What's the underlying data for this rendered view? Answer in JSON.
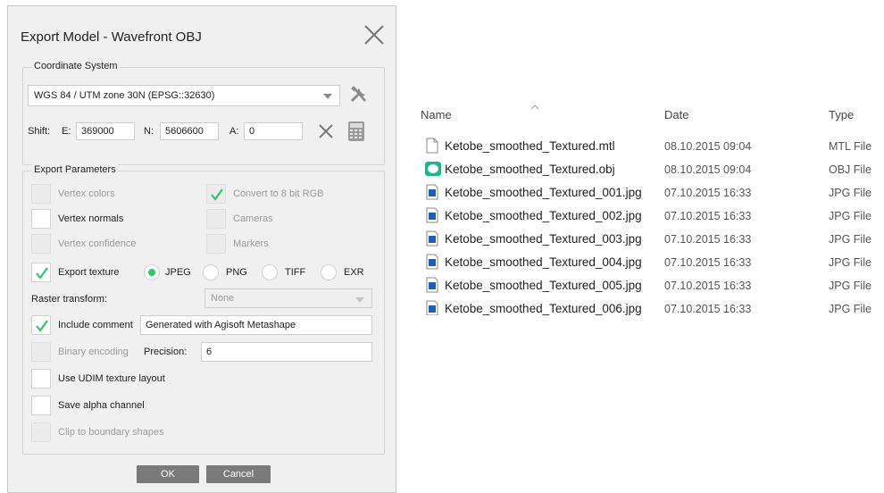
{
  "dialog": {
    "title": "Export Model - Wavefront OBJ",
    "coordinate_system": {
      "group_title": "Coordinate System",
      "crs_value": "WGS 84 / UTM zone 30N (EPSG::32630)",
      "shift_label": "Shift:",
      "e_label": "E:",
      "e_value": "369000",
      "n_label": "N:",
      "n_value": "5606600",
      "a_label": "A:",
      "a_value": "0"
    },
    "export_parameters": {
      "group_title": "Export Parameters",
      "vertex_colors": "Vertex colors",
      "convert_8bit": "Convert to 8 bit RGB",
      "vertex_normals": "Vertex normals",
      "cameras": "Cameras",
      "vertex_confidence": "Vertex confidence",
      "markers": "Markers",
      "export_texture": "Export texture",
      "format_jpeg": "JPEG",
      "format_png": "PNG",
      "format_tiff": "TIFF",
      "format_exr": "EXR",
      "raster_transform_label": "Raster transform:",
      "raster_transform_value": "None",
      "include_comment": "Include comment",
      "comment_value": "Generated with Agisoft Metashape",
      "binary_encoding": "Binary encoding",
      "precision_label": "Precision:",
      "precision_value": "6",
      "udim": "Use UDIM texture layout",
      "save_alpha": "Save alpha channel",
      "clip_boundary": "Clip to boundary shapes"
    },
    "ok_label": "OK",
    "cancel_label": "Cancel",
    "accent_color": "#2ec866"
  },
  "file_list": {
    "columns": {
      "name": "Name",
      "date": "Date",
      "type": "Type"
    },
    "files": [
      {
        "name": "Ketobe_smoothed_Textured.mtl",
        "date": "08.10.2015 09:04",
        "type": "MTL File",
        "icon": "document-icon"
      },
      {
        "name": "Ketobe_smoothed_Textured.obj",
        "date": "08.10.2015 09:04",
        "type": "OBJ File",
        "icon": "obj-file-icon"
      },
      {
        "name": "Ketobe_smoothed_Textured_001.jpg",
        "date": "07.10.2015 16:33",
        "type": "JPG File",
        "icon": "image-file-icon"
      },
      {
        "name": "Ketobe_smoothed_Textured_002.jpg",
        "date": "07.10.2015 16:33",
        "type": "JPG File",
        "icon": "image-file-icon"
      },
      {
        "name": "Ketobe_smoothed_Textured_003.jpg",
        "date": "07.10.2015 16:33",
        "type": "JPG File",
        "icon": "image-file-icon"
      },
      {
        "name": "Ketobe_smoothed_Textured_004.jpg",
        "date": "07.10.2015 16:33",
        "type": "JPG File",
        "icon": "image-file-icon"
      },
      {
        "name": "Ketobe_smoothed_Textured_005.jpg",
        "date": "07.10.2015 16:33",
        "type": "JPG File",
        "icon": "image-file-icon"
      },
      {
        "name": "Ketobe_smoothed_Textured_006.jpg",
        "date": "07.10.2015 16:33",
        "type": "JPG File",
        "icon": "image-file-icon"
      }
    ]
  }
}
